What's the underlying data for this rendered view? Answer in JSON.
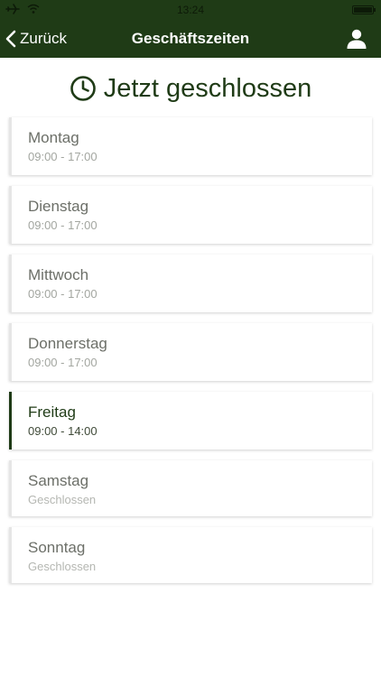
{
  "status_bar": {
    "time": "13:24"
  },
  "nav": {
    "back_label": "Zurück",
    "title": "Geschäftszeiten"
  },
  "status": {
    "label": "Jetzt geschlossen"
  },
  "days": [
    {
      "name": "Montag",
      "hours": "09:00 - 17:00"
    },
    {
      "name": "Dienstag",
      "hours": "09:00 - 17:00"
    },
    {
      "name": "Mittwoch",
      "hours": "09:00 - 17:00"
    },
    {
      "name": "Donnerstag",
      "hours": "09:00 - 17:00"
    },
    {
      "name": "Freitag",
      "hours": "09:00 - 14:00"
    },
    {
      "name": "Samstag",
      "hours": "Geschlossen"
    },
    {
      "name": "Sonntag",
      "hours": "Geschlossen"
    }
  ],
  "colors": {
    "brand": "#1f3b16",
    "background": "#ffffff",
    "text_muted": "#6c6f68",
    "text_light": "#a3a6a0"
  },
  "icons": {
    "back": "chevron-left-icon",
    "user": "user-icon",
    "clock": "clock-icon",
    "airplane": "airplane-icon",
    "wifi": "wifi-icon",
    "battery": "battery-icon"
  }
}
